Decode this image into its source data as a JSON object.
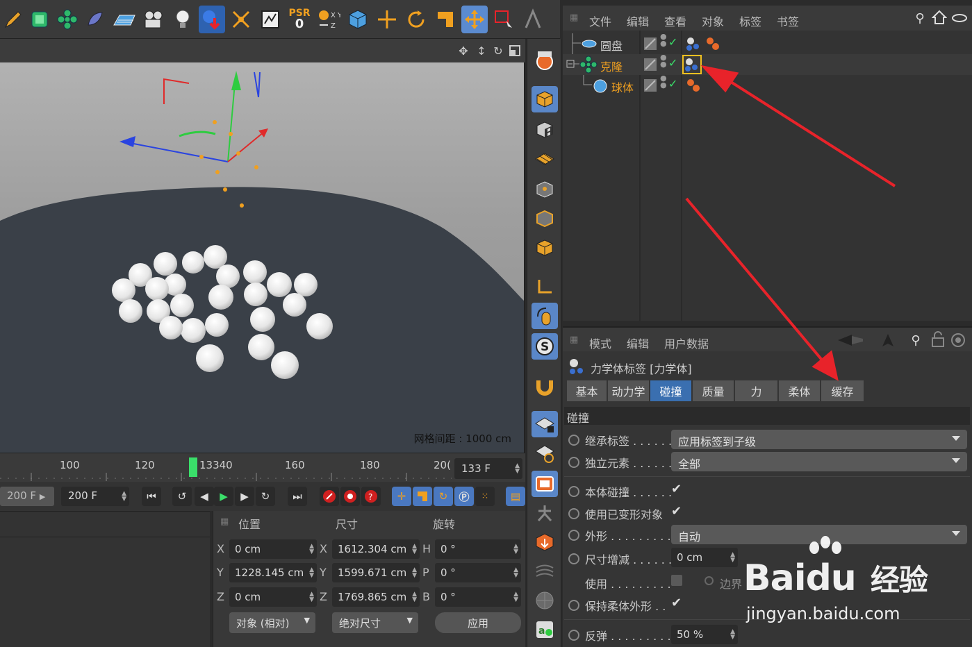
{
  "toolbar": {
    "psr_label": "PSR",
    "psr_value": "0"
  },
  "viewport": {
    "grid_label": "网格间距 : 1000 cm"
  },
  "timeline": {
    "ticks": [
      "100",
      "120",
      "13340",
      "160",
      "180",
      "20("
    ],
    "current_frame": "133 F"
  },
  "playback": {
    "end_frame_left": "200 F",
    "end_frame": "200 F"
  },
  "coordinates": {
    "headers": {
      "position": "位置",
      "size": "尺寸",
      "rotation": "旋转"
    },
    "axes": [
      "X",
      "Y",
      "Z"
    ],
    "size_axes": [
      "X",
      "Y",
      "Z"
    ],
    "rot_axes": [
      "H",
      "P",
      "B"
    ],
    "position": [
      "0 cm",
      "1228.145 cm",
      "0 cm"
    ],
    "size": [
      "1612.304 cm",
      "1599.671 cm",
      "1769.865 cm"
    ],
    "rotation": [
      "0 °",
      "0 °",
      "0 °"
    ],
    "mode_dropdown": "对象 (相对)",
    "size_dropdown": "绝对尺寸",
    "apply_button": "应用"
  },
  "object_manager": {
    "menu": [
      "文件",
      "编辑",
      "查看",
      "对象",
      "标签",
      "书签"
    ],
    "objects": [
      {
        "name": "圆盘",
        "color": "#cfcfcf"
      },
      {
        "name": "克隆",
        "color": "#f0a020"
      },
      {
        "name": "球体",
        "color": "#f0a020"
      }
    ]
  },
  "attribute_manager": {
    "menu": [
      "模式",
      "编辑",
      "用户数据"
    ],
    "tag_title": "力学体标签 [力学体]",
    "tabs": [
      "基本",
      "动力学",
      "碰撞",
      "质量",
      "力",
      "柔体",
      "缓存"
    ],
    "active_tab": "碰撞",
    "section": "碰撞",
    "props": {
      "inherit_label": "继承标签 . . . . . .",
      "inherit_value": "应用标签到子级",
      "independent_label": "独立元素 . . . . . .",
      "independent_value": "全部",
      "self_collision_label": "本体碰撞 . . . . . .",
      "deformed_label": "使用已变形对象",
      "shape_label": "外形  . . . . . . . . .",
      "shape_value": "自动",
      "size_inc_label": "尺寸增减 . . . . . .",
      "size_inc_value": "0 cm",
      "use_label": "使用  . . . . . . . . .",
      "border_label": "边界",
      "keep_soft_label": "保持柔体外形 . .",
      "bounce_label": "反弹  . . . . . . . . .",
      "bounce_value": "50 %"
    }
  },
  "watermark": {
    "brand": "Bai",
    "brand2": "du",
    "jingyan": "经验",
    "url": "jingyan.baidu.com"
  },
  "colors": {
    "accent_blue": "#3a6fb0",
    "arrow_red": "#e8232a",
    "orange": "#f0a020"
  }
}
